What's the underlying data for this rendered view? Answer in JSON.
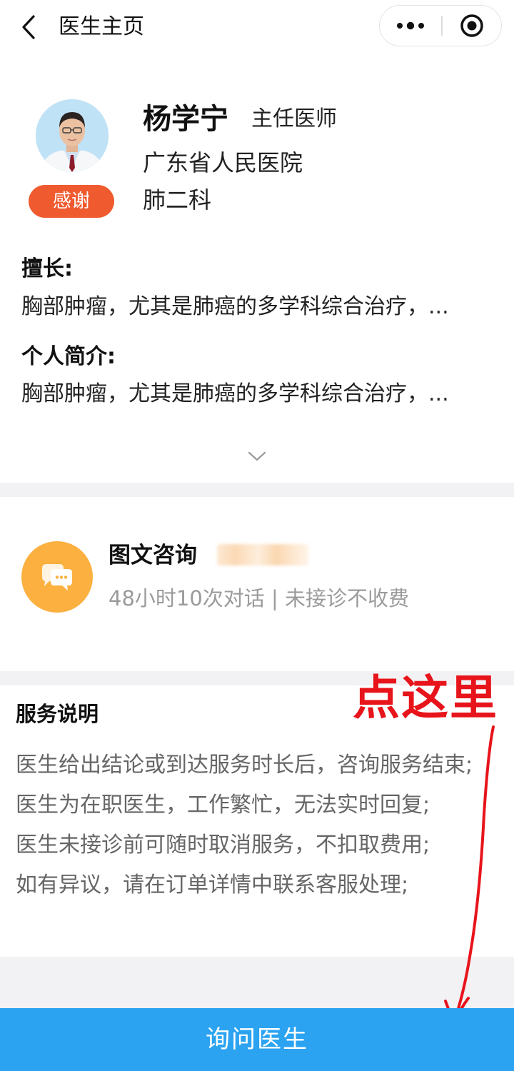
{
  "nav": {
    "title": "医生主页"
  },
  "doctor": {
    "name": "杨学宁",
    "title": "主任医师",
    "hospital": "广东省人民医院",
    "department": "肺二科",
    "thanks_label": "感谢"
  },
  "specialty": {
    "label": "擅长:",
    "text": "胸部肿瘤，尤其是肺癌的多学科综合治疗，..."
  },
  "bio": {
    "label": "个人简介:",
    "text": "胸部肿瘤，尤其是肺癌的多学科综合治疗，..."
  },
  "consult": {
    "title": "图文咨询",
    "subtitle": "48小时10次对话 | 未接诊不收费",
    "icon": "chat-bubbles-icon"
  },
  "service": {
    "title": "服务说明",
    "items": [
      "医生给出结论或到达服务时长后，咨询服务结束;",
      "医生为在职医生，工作繁忙，无法实时回复;",
      "医生未接诊前可随时取消服务，不扣取费用;",
      "如有异议，请在订单详情中联系客服处理;"
    ]
  },
  "annotation": {
    "text": "点这里"
  },
  "cta": {
    "label": "询问医生"
  },
  "colors": {
    "accent_blue": "#2ba3f1",
    "thanks_orange": "#ef5a2e",
    "consult_icon_bg": "#fbb040",
    "annotation_red": "#e8141b"
  }
}
